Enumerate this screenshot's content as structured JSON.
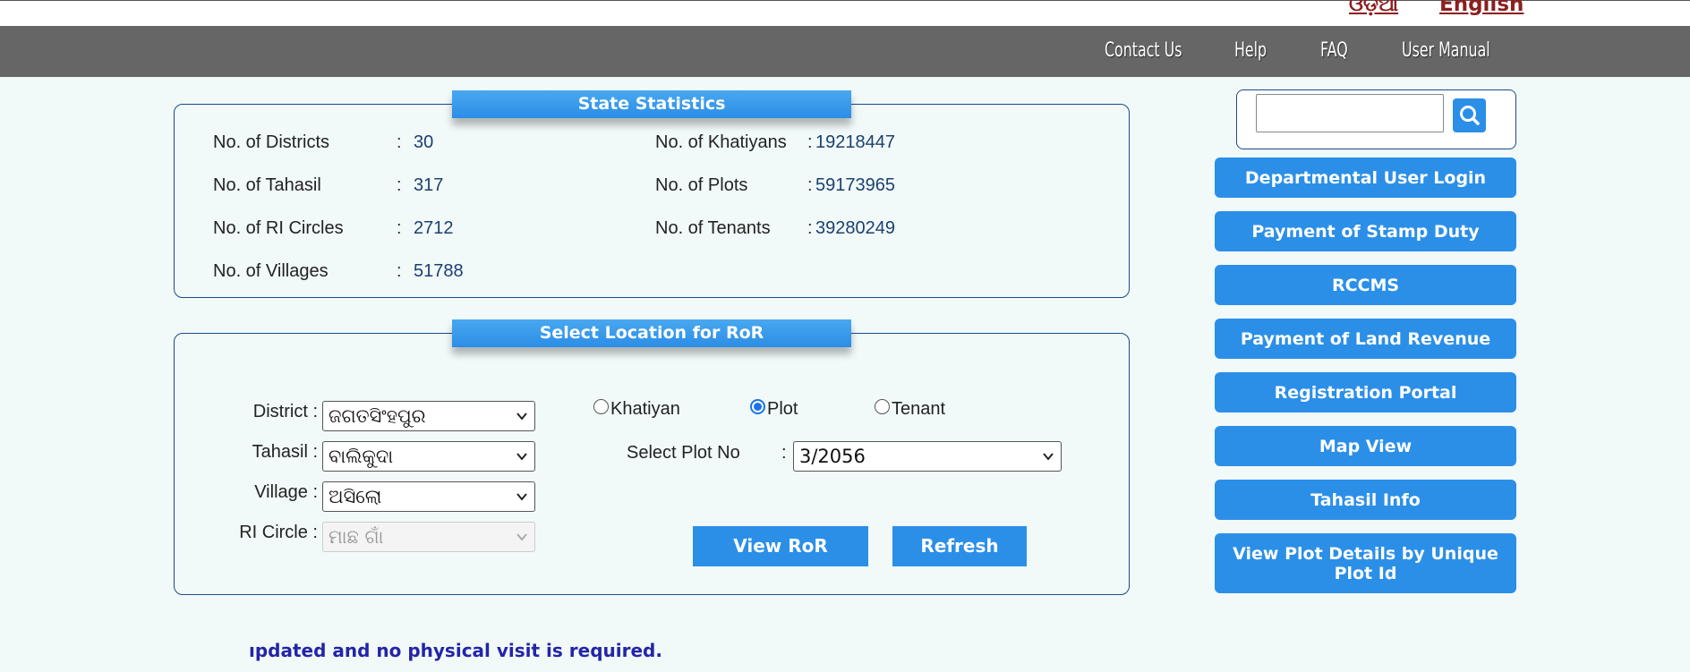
{
  "languages": {
    "odia": "ଓଡ଼ିଆ",
    "english": "English"
  },
  "nav": {
    "contact": "Contact Us",
    "help": "Help",
    "faq": "FAQ",
    "manual": "User Manual"
  },
  "stats": {
    "title": "State Statistics",
    "colon": ":",
    "districts": {
      "label": "No. of Districts",
      "value": "30"
    },
    "tahasil": {
      "label": "No. of Tahasil",
      "value": "317"
    },
    "ri_circles": {
      "label": "No. of RI Circles",
      "value": "2712"
    },
    "villages": {
      "label": "No. of Villages",
      "value": "51788"
    },
    "khatiyans": {
      "label": "No. of Khatiyans",
      "value": "19218447"
    },
    "plots": {
      "label": "No. of Plots",
      "value": "59173965"
    },
    "tenants": {
      "label": "No. of Tenants",
      "value": "39280249"
    }
  },
  "location": {
    "title": "Select Location for RoR",
    "district": {
      "label": "District :",
      "value": "ଜଗତସିଂହପୁର"
    },
    "tahasil": {
      "label": "Tahasil :",
      "value": "ବାଲିକୁଦା"
    },
    "village": {
      "label": "Village :",
      "value": "ଅସିଲୋ"
    },
    "ri_circle": {
      "label": "RI Circle :",
      "value": "ମାଛ ଗାଁ"
    },
    "search_type": {
      "options": [
        "Khatiyan",
        "Plot",
        "Tenant"
      ],
      "selected": "Plot"
    },
    "plot_no": {
      "label": "Select Plot No",
      "colon": ":",
      "value": "3/2056"
    },
    "view_button": "View RoR",
    "refresh_button": "Refresh"
  },
  "sidebar": {
    "buttons": [
      "Departmental User Login",
      "Payment of Stamp Duty",
      "RCCMS",
      "Payment of Land Revenue",
      "Registration Portal",
      "Map View",
      "Tahasil Info",
      "View Plot Details by Unique Plot Id"
    ]
  },
  "marquee": "ıpdated and no physical visit is required.",
  "colors": {
    "accent": "#2b8fe8",
    "nav_bg": "#666666",
    "page_bg": "#f1faf9",
    "lang_link": "#8b1f1f",
    "marquee": "#2424a8"
  }
}
